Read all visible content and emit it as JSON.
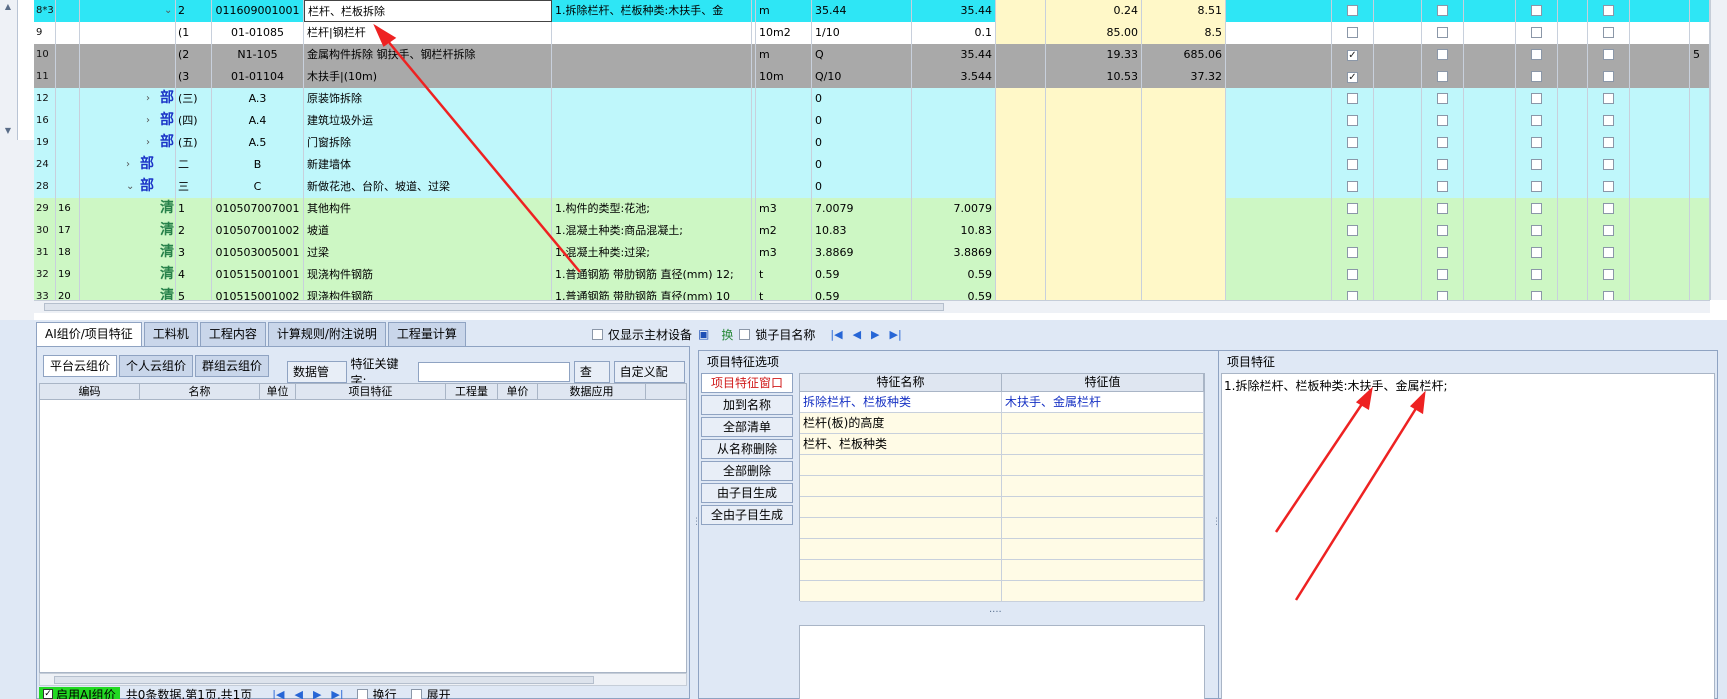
{
  "grid_rows": [
    {
      "rn": "8*3",
      "sub": "",
      "style": "r-sel",
      "depth": 3,
      "expand": "v",
      "mark": "清",
      "mark_type": "qing",
      "seq": "2",
      "code": "011609001001",
      "name": "栏杆、栏板拆除",
      "feat": "1.拆除栏杆、栏板种类:木扶手、金",
      "unit": "m",
      "expr": "35.44",
      "qty": "35.44",
      "price": "0.24",
      "total": "8.51",
      "chk": [
        false,
        false,
        false,
        false
      ],
      "rest": ""
    },
    {
      "rn": "9",
      "sub": "",
      "style": "r-white",
      "depth": 4,
      "expand": "",
      "mark": "子",
      "mark_type": "zi",
      "seq": "(1",
      "code": "01-01085",
      "name": "栏杆|钢栏杆",
      "feat": "",
      "unit": "10m2",
      "expr": "1/10",
      "qty": "0.1",
      "price": "85.00",
      "total": "8.5",
      "chk": [
        false,
        false,
        false,
        false
      ],
      "rest": ""
    },
    {
      "rn": "10",
      "sub": "",
      "style": "r-gray",
      "depth": 4,
      "expand": "",
      "mark": "子",
      "mark_type": "zi",
      "seq": "(2",
      "code": "N1-105",
      "name": "金属构件拆除 钢扶手、钢栏杆拆除",
      "feat": "",
      "unit": "m",
      "expr": "Q",
      "qty": "35.44",
      "price": "19.33",
      "total": "685.06",
      "chk": [
        true,
        false,
        false,
        false
      ],
      "rest": "5"
    },
    {
      "rn": "11",
      "sub": "",
      "style": "r-gray",
      "depth": 4,
      "expand": "",
      "mark": "子",
      "mark_type": "zi",
      "seq": "(3",
      "code": "01-01104",
      "name": "木扶手|(10m)",
      "feat": "",
      "unit": "10m",
      "expr": "Q/10",
      "qty": "3.544",
      "price": "10.53",
      "total": "37.32",
      "chk": [
        true,
        false,
        false,
        false
      ],
      "rest": ""
    },
    {
      "rn": "12",
      "sub": "",
      "style": "r-cyan",
      "depth": 2,
      "expand": ">",
      "mark": "部",
      "mark_type": "bu",
      "seq": "(三)",
      "code": "A.3",
      "name": "原装饰拆除",
      "feat": "",
      "unit": "",
      "expr": "0",
      "qty": "",
      "price": "",
      "total": "",
      "chk": [
        false,
        false,
        false,
        false
      ],
      "rest": ""
    },
    {
      "rn": "16",
      "sub": "",
      "style": "r-cyan",
      "depth": 2,
      "expand": ">",
      "mark": "部",
      "mark_type": "bu",
      "seq": "(四)",
      "code": "A.4",
      "name": "建筑垃圾外运",
      "feat": "",
      "unit": "",
      "expr": "0",
      "qty": "",
      "price": "",
      "total": "",
      "chk": [
        false,
        false,
        false,
        false
      ],
      "rest": ""
    },
    {
      "rn": "19",
      "sub": "",
      "style": "r-cyan",
      "depth": 2,
      "expand": ">",
      "mark": "部",
      "mark_type": "bu",
      "seq": "(五)",
      "code": "A.5",
      "name": "门窗拆除",
      "feat": "",
      "unit": "",
      "expr": "0",
      "qty": "",
      "price": "",
      "total": "",
      "chk": [
        false,
        false,
        false,
        false
      ],
      "rest": ""
    },
    {
      "rn": "24",
      "sub": "",
      "style": "r-cyan",
      "depth": 1,
      "expand": ">",
      "mark": "部",
      "mark_type": "bu",
      "seq": "二",
      "code": "B",
      "name": "新建墙体",
      "feat": "",
      "unit": "",
      "expr": "0",
      "qty": "",
      "price": "",
      "total": "",
      "chk": [
        false,
        false,
        false,
        false
      ],
      "rest": ""
    },
    {
      "rn": "28",
      "sub": "",
      "style": "r-cyan",
      "depth": 1,
      "expand": "v",
      "mark": "部",
      "mark_type": "bu",
      "seq": "三",
      "code": "C",
      "name": "新做花池、台阶、坡道、过梁",
      "feat": "",
      "unit": "",
      "expr": "0",
      "qty": "",
      "price": "",
      "total": "",
      "chk": [
        false,
        false,
        false,
        false
      ],
      "rest": ""
    },
    {
      "rn": "29",
      "sub": "16",
      "style": "r-green",
      "depth": 2,
      "expand": "",
      "mark": "清",
      "mark_type": "qing",
      "seq": "1",
      "code": "010507007001",
      "name": "其他构件",
      "feat": "1.构件的类型:花池;",
      "unit": "m3",
      "expr": "7.0079",
      "qty": "7.0079",
      "price": "",
      "total": "",
      "chk": [
        false,
        false,
        false,
        false
      ],
      "rest": ""
    },
    {
      "rn": "30",
      "sub": "17",
      "style": "r-green",
      "depth": 2,
      "expand": "",
      "mark": "清",
      "mark_type": "qing",
      "seq": "2",
      "code": "010507001002",
      "name": "坡道",
      "feat": "1.混凝土种类:商品混凝土;",
      "unit": "m2",
      "expr": "10.83",
      "qty": "10.83",
      "price": "",
      "total": "",
      "chk": [
        false,
        false,
        false,
        false
      ],
      "rest": ""
    },
    {
      "rn": "31",
      "sub": "18",
      "style": "r-green",
      "depth": 2,
      "expand": "",
      "mark": "清",
      "mark_type": "qing",
      "seq": "3",
      "code": "010503005001",
      "name": "过梁",
      "feat": "1.混凝土种类:过梁;",
      "unit": "m3",
      "expr": "3.8869",
      "qty": "3.8869",
      "price": "",
      "total": "",
      "chk": [
        false,
        false,
        false,
        false
      ],
      "rest": ""
    },
    {
      "rn": "32",
      "sub": "19",
      "style": "r-green",
      "depth": 2,
      "expand": "",
      "mark": "清",
      "mark_type": "qing",
      "seq": "4",
      "code": "010515001001",
      "name": "现浇构件钢筋",
      "feat": "1.普通钢筋 带肋钢筋 直径(mm) 12;",
      "unit": "t",
      "expr": "0.59",
      "qty": "0.59",
      "price": "",
      "total": "",
      "chk": [
        false,
        false,
        false,
        false
      ],
      "rest": ""
    },
    {
      "rn": "33",
      "sub": "20",
      "style": "r-green",
      "depth": 2,
      "expand": "",
      "mark": "清",
      "mark_type": "qing",
      "seq": "5",
      "code": "010515001002",
      "name": "现浇构件钢筋",
      "feat": "1.普通钢筋 带肋钢筋 直径(mm) 10",
      "unit": "t",
      "expr": "0.59",
      "qty": "0.59",
      "price": "",
      "total": "",
      "chk": [
        false,
        false,
        false,
        false
      ],
      "rest": ""
    }
  ],
  "tabs": [
    "AI组价/项目特征",
    "工料机",
    "工程内容",
    "计算规则/附注说明",
    "工程量计算"
  ],
  "toolbar": {
    "main_material_only": "仅显示主材设备",
    "swap_label": "换",
    "lock_name": "锁子目名称"
  },
  "left_panel": {
    "cloud_tabs": [
      "平台云组价",
      "个人云组价",
      "群组云组价"
    ],
    "data_manage": "数据管理",
    "keyword_label": "特征关键字:",
    "search": "查找",
    "custom_config": "自定义配置",
    "table_headers": [
      "编码",
      "名称",
      "单位",
      "项目特征",
      "工程量",
      "单价",
      "数据应用"
    ],
    "footer": {
      "ai_enable": "启用AI组价",
      "count": "共0条数据,第1页,共1页",
      "wrap": "换行",
      "expand": "展开"
    }
  },
  "mid_panel": {
    "title": "项目特征选项",
    "buttons": [
      "项目特征窗口",
      "加到名称",
      "全部清单",
      "从名称删除",
      "全部删除",
      "由子目生成",
      "全由子目生成"
    ],
    "headers": [
      "特征名称",
      "特征值"
    ],
    "rows": [
      {
        "name": "拆除栏杆、栏板种类",
        "value": "木扶手、金属栏杆",
        "hl": true
      },
      {
        "name": "栏杆(板)的高度",
        "value": "",
        "hl": false
      },
      {
        "name": "栏杆、栏板种类",
        "value": "",
        "hl": false
      },
      {
        "name": "",
        "value": "",
        "hl": false
      },
      {
        "name": "",
        "value": "",
        "hl": false
      },
      {
        "name": "",
        "value": "",
        "hl": false
      },
      {
        "name": "",
        "value": "",
        "hl": false
      },
      {
        "name": "",
        "value": "",
        "hl": false
      },
      {
        "name": "",
        "value": "",
        "hl": false
      },
      {
        "name": "",
        "value": "",
        "hl": false
      }
    ]
  },
  "right_panel": {
    "title": "项目特征",
    "text": "1.拆除栏杆、栏板种类:木扶手、金属栏杆;"
  },
  "colors": {
    "selected_row": "#2ee6f5",
    "section_row": "#bff7fb",
    "bill_row": "#cdf7c4",
    "disabled_row": "#a9a9a9",
    "annotation_arrow": "#ee2222"
  }
}
